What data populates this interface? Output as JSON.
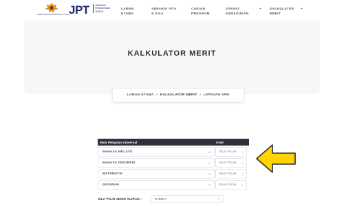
{
  "header": {
    "ministry": "KEMENTERIAN PENDIDIKAN TINGGI",
    "logo": "JPT",
    "logo_sub": "JABATAN PENDIDIKAN TINGGI",
    "nav": [
      {
        "label": "LAMAN UTAMA",
        "has_dropdown": false
      },
      {
        "label": "SENARAI IPTA & ILKA",
        "has_dropdown": false
      },
      {
        "label": "CARIAN PROGRAM",
        "has_dropdown": false
      },
      {
        "label": "SYARAT KEMASUKAN",
        "has_dropdown": true
      },
      {
        "label": "KALKULATOR MERIT",
        "has_dropdown": true
      }
    ]
  },
  "hero": {
    "title": "KALKULATOR MERIT"
  },
  "breadcrumb": {
    "items": [
      "LAMAN UTAMA",
      "KALKULATOR MERIT",
      "LEPASAN SPM"
    ],
    "separator": ">"
  },
  "table": {
    "col_subject": "Mata Pelajaran Universal",
    "col_grade": "Gred",
    "rows": [
      {
        "subject": "BAHASA MELAYU",
        "grade": "SILA PILIH"
      },
      {
        "subject": "BAHASA INGGERIS",
        "grade": "SILA PILIH"
      },
      {
        "subject": "MATEMATIK",
        "grade": "SILA PILIH"
      },
      {
        "subject": "SEJARAH",
        "grade": "SILA PILIH"
      }
    ]
  },
  "stream": {
    "label": "SILA PILIH JENIS ALIRAN :",
    "value": "STEM A"
  },
  "icons": {
    "chevron": "chevron-down-icon",
    "arrow": "arrow-left-icon",
    "crest": "crest-icon"
  },
  "colors": {
    "arrow_fill": "#ffd400",
    "header_dark": "#30303c",
    "brand": "#1b2a6b"
  }
}
